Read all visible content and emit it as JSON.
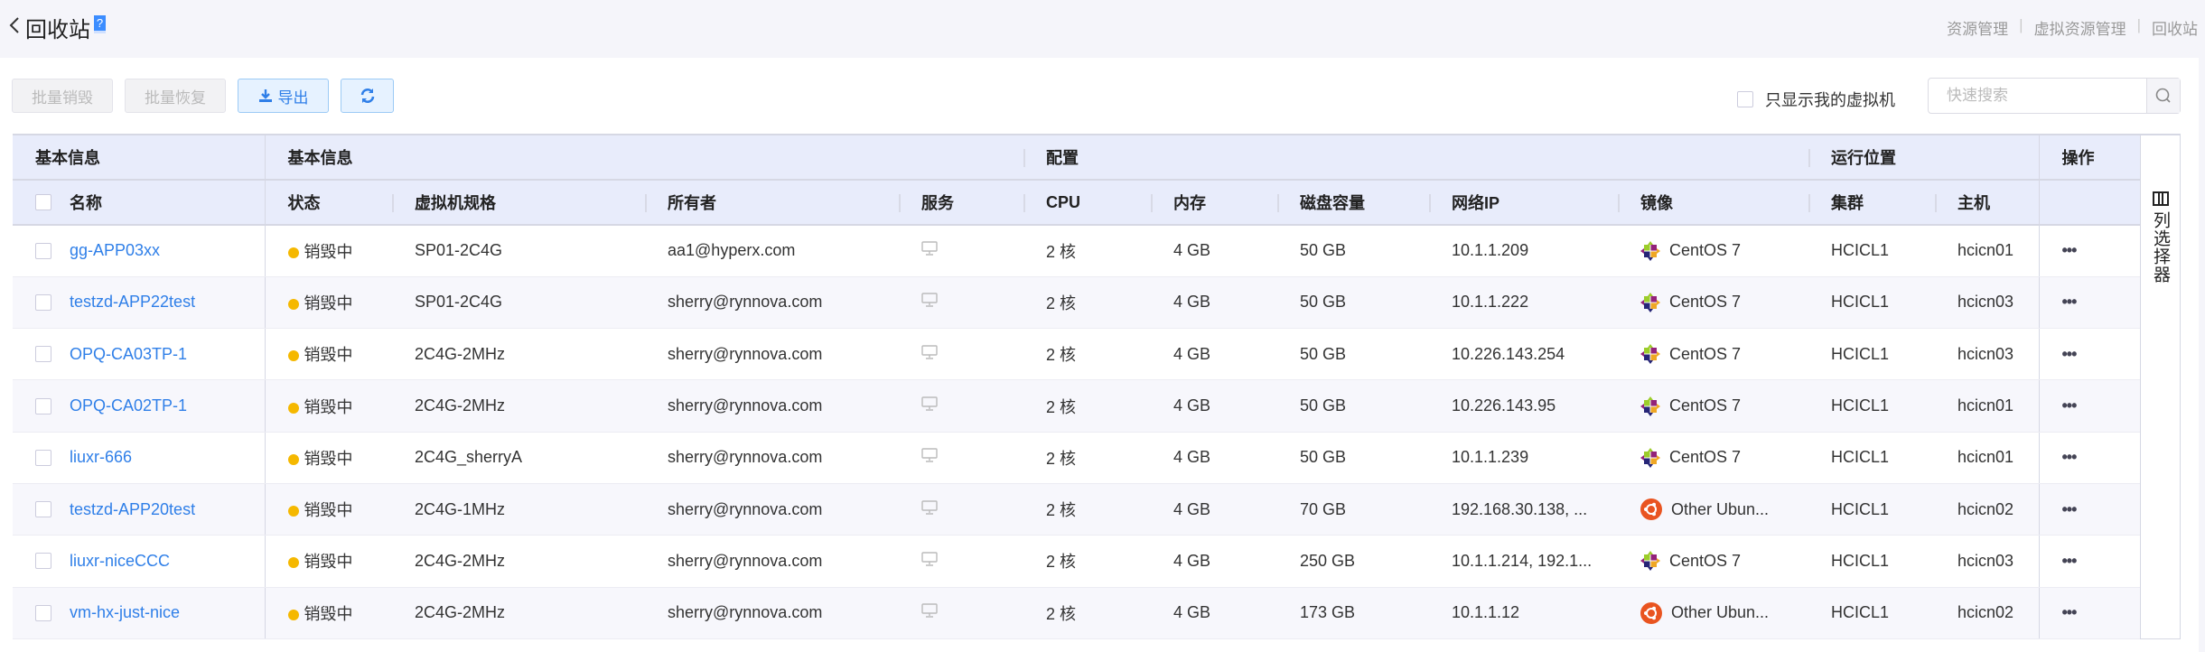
{
  "header": {
    "title": "回收站",
    "help": "?",
    "breadcrumb": [
      "资源管理",
      "虚拟资源管理",
      "回收站"
    ],
    "breadcrumb_sep": "|"
  },
  "toolbar": {
    "batch_destroy": "批量销毁",
    "batch_restore": "批量恢复",
    "export": "导出",
    "only_mine": "只显示我的虚拟机",
    "search_placeholder": "快速搜索"
  },
  "table": {
    "groups": [
      "基本信息",
      "基本信息",
      "配置",
      "运行位置",
      "操作"
    ],
    "columns": [
      "名称",
      "状态",
      "虚拟机规格",
      "所有者",
      "服务",
      "CPU",
      "内存",
      "磁盘容量",
      "网络IP",
      "镜像",
      "集群",
      "主机"
    ],
    "rows": [
      {
        "name": "gg-APP03xx",
        "status": "销毁中",
        "spec": "SP01-2C4G",
        "owner": "aa1@hyperx.com",
        "cpu": "2 核",
        "mem": "4 GB",
        "disk": "50 GB",
        "ip": "10.1.1.209",
        "image": "CentOS 7",
        "os": "centos",
        "cluster": "HCICL1",
        "host": "hcicn01"
      },
      {
        "name": "testzd-APP22test",
        "status": "销毁中",
        "spec": "SP01-2C4G",
        "owner": "sherry@rynnova.com",
        "cpu": "2 核",
        "mem": "4 GB",
        "disk": "50 GB",
        "ip": "10.1.1.222",
        "image": "CentOS 7",
        "os": "centos",
        "cluster": "HCICL1",
        "host": "hcicn03"
      },
      {
        "name": "OPQ-CA03TP-1",
        "status": "销毁中",
        "spec": "2C4G-2MHz",
        "owner": "sherry@rynnova.com",
        "cpu": "2 核",
        "mem": "4 GB",
        "disk": "50 GB",
        "ip": "10.226.143.254",
        "image": "CentOS 7",
        "os": "centos",
        "cluster": "HCICL1",
        "host": "hcicn03"
      },
      {
        "name": "OPQ-CA02TP-1",
        "status": "销毁中",
        "spec": "2C4G-2MHz",
        "owner": "sherry@rynnova.com",
        "cpu": "2 核",
        "mem": "4 GB",
        "disk": "50 GB",
        "ip": "10.226.143.95",
        "image": "CentOS 7",
        "os": "centos",
        "cluster": "HCICL1",
        "host": "hcicn01"
      },
      {
        "name": "liuxr-666",
        "status": "销毁中",
        "spec": "2C4G_sherryA",
        "owner": "sherry@rynnova.com",
        "cpu": "2 核",
        "mem": "4 GB",
        "disk": "50 GB",
        "ip": "10.1.1.239",
        "image": "CentOS 7",
        "os": "centos",
        "cluster": "HCICL1",
        "host": "hcicn01"
      },
      {
        "name": "testzd-APP20test",
        "status": "销毁中",
        "spec": "2C4G-1MHz",
        "owner": "sherry@rynnova.com",
        "cpu": "2 核",
        "mem": "4 GB",
        "disk": "70 GB",
        "ip": "192.168.30.138, ...",
        "image": "Other Ubun...",
        "os": "ubuntu",
        "cluster": "HCICL1",
        "host": "hcicn02"
      },
      {
        "name": "liuxr-niceCCC",
        "status": "销毁中",
        "spec": "2C4G-2MHz",
        "owner": "sherry@rynnova.com",
        "cpu": "2 核",
        "mem": "4 GB",
        "disk": "250 GB",
        "ip": "10.1.1.214, 192.1...",
        "image": "CentOS 7",
        "os": "centos",
        "cluster": "HCICL1",
        "host": "hcicn03"
      },
      {
        "name": "vm-hx-just-nice",
        "status": "销毁中",
        "spec": "2C4G-2MHz",
        "owner": "sherry@rynnova.com",
        "cpu": "2 核",
        "mem": "4 GB",
        "disk": "173 GB",
        "ip": "10.1.1.12",
        "image": "Other Ubun...",
        "os": "ubuntu",
        "cluster": "HCICL1",
        "host": "hcicn02"
      }
    ],
    "more": "•••"
  },
  "column_selector": "列选择器",
  "colors": {
    "accent": "#2f7fe8",
    "status_destroying": "#f5b800",
    "header_bg": "#e8ecfb",
    "ubuntu": "#e95420"
  }
}
